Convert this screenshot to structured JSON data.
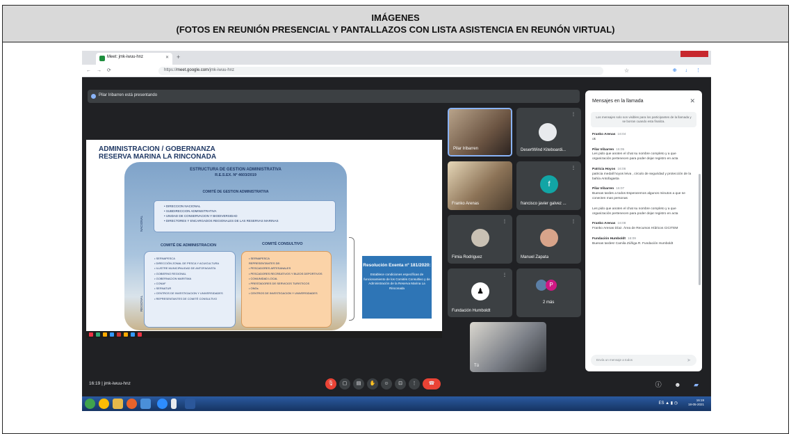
{
  "header": {
    "title": "IMÁGENES",
    "subtitle": "(FOTOS EN REUNIÓN PRESENCIAL Y PANTALLAZOS CON LISTA ASISTENCIA EN REUNÓN VIRTUAL)"
  },
  "browser": {
    "tab_title": "Meet: jmk-iwuu-hnz",
    "tab_sub": "REPRODUCIENDO",
    "url_prefix": "https://",
    "url_host": "meet.google.com",
    "url_path": "/jmk-iwuu-hnz"
  },
  "meet": {
    "presenting": "Pilar Iribarren está presentando",
    "meeting_code": "16:19  |  jmk-iwuu-hnz",
    "accent": "#8ab4f8",
    "end_color": "#ea4335"
  },
  "slide": {
    "title_1": "ADMINISTRACION / GOBERNANZA",
    "title_2": "RESERVA MARINA LA RINCONADA",
    "structure_title": "ESTRUCTURA DE GESTION ADMINISTRATIVA",
    "structure_res": "R.E.S.EX. Nº 4603/2019",
    "committee_admin_mgmt": "COMITÉ DE GESTION ADMINISTRATIVA",
    "national_label": "NACIONAL",
    "regional_label": "REGIONAL",
    "national_items": [
      "DIRECCION NACIONAL",
      "SUBDIRECCION ADMINISTRATIVA",
      "UNIDAD DE CONSERVACION Y BIODIVERSIDAD",
      "DIRECTORES Y ENCARGADOS REGIONALES DE LAS RESERVAS MARINAS"
    ],
    "admin_committee": "COMITÉ DE ADMINISTRACION",
    "consultive_committee": "COMITÉ CONSULTIVO",
    "admin_items": [
      "SERNAPESCA",
      "DIRECCIÓN ZONAL DE PESCA Y ACUICULTURA",
      "ILUSTRE MUNICIPALIDAD DE ANTOFAGASTA",
      "GOBIERNO REGIONAL",
      "GOBERNACION MARITIMA",
      "CONAF",
      "SERNATUR",
      "CENTROS DE INVESTIGACION Y UNIVERSIDADES",
      "REPRESENTANTES DE COMITÉ CONSULTIVO"
    ],
    "consult_items": [
      "SERNAPESCA",
      "REPRESENTANTES DE:",
      "PESCADORES ARTESANALES",
      "PESCADORES RECREATIVOS Y BUZOS DEPORTIVOS",
      "COMUNIDAD LOCAL",
      "PRESTADORES DE SERVICIOS TURISTICOS",
      "ONGs",
      "CENTROS DE INVESTIGACION Y UNIVERSIDADES"
    ],
    "resolution_title": "Resolución Exenta nº 181/2020:",
    "resolution_text": "Establece condiciones específicas de funcionamiento de los Comités Consultivo y de Administración de la Reserva Marina La Rinconada"
  },
  "participants": [
    {
      "name": "Pilar Iribarren"
    },
    {
      "name": "DesertWind Kiteboardi..."
    },
    {
      "name": "Franko Arenas"
    },
    {
      "name": "francisco javier galvez ..."
    },
    {
      "name": "Fimia Rodriguez"
    },
    {
      "name": "Manuel Zapata"
    },
    {
      "name": "Fundación Humboldt"
    },
    {
      "name": "2 más"
    },
    {
      "name": "Tú"
    }
  ],
  "chat": {
    "title": "Mensajes en la llamada",
    "notice": "Los mensajes solo son visibles para los participantes de la llamada y se borran cuando esta finaliza.",
    "messages": [
      {
        "who": "Franko Arenas",
        "time": "16:04",
        "text": "ok"
      },
      {
        "who": "Pilar Iribarren",
        "time": "16:05",
        "text": "Les pido que anoten el chat su nombre completo y a que organización pertenecen para poder dejar registro en acta"
      },
      {
        "who": "Patricia Hoyos",
        "time": "16:06",
        "text": "patricia medall hoyos leiva , circulo de seguridad y protección de la bahía Antofagasta"
      },
      {
        "who": "Pilar Iribarren",
        "time": "16:07",
        "text": "Buenas tardes a todos Esperaremos algunos minutos a que se conecten mas personas"
      },
      {
        "who": "",
        "time": "",
        "text": "Les pido que anoten el chat su nombre completo y a que organización pertenecen para poder dejar registro en acta"
      },
      {
        "who": "Franko Arenas",
        "time": "16:08",
        "text": "Franko Arenas Díaz. Área de Recursos Hídricos CICITEM"
      },
      {
        "who": "Fundación Humboldt",
        "time": "16:09",
        "text": "Buenas tardes! Camila Zúñiga R. Fundación Humboldt"
      }
    ],
    "input_placeholder": "Envía un mensaje a todos"
  },
  "taskbar": {
    "time": "16:19",
    "date": "18-05-2021"
  }
}
